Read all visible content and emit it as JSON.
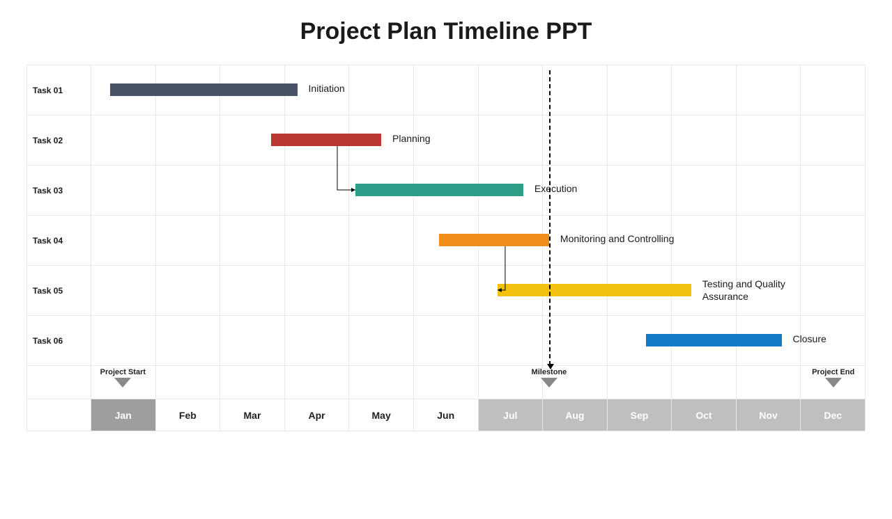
{
  "title": "Project Plan Timeline PPT",
  "months": [
    "Jan",
    "Feb",
    "Mar",
    "Apr",
    "May",
    "Jun",
    "Jul",
    "Aug",
    "Sep",
    "Oct",
    "Nov",
    "Dec"
  ],
  "tasks": [
    {
      "rowLabel": "Task 01",
      "label": "Initiation"
    },
    {
      "rowLabel": "Task 02",
      "label": "Planning"
    },
    {
      "rowLabel": "Task 03",
      "label": "Execution"
    },
    {
      "rowLabel": "Task 04",
      "label": "Monitoring and Controlling"
    },
    {
      "rowLabel": "Task 05",
      "label": "Testing and Quality Assurance"
    },
    {
      "rowLabel": "Task 06",
      "label": "Closure"
    }
  ],
  "markers": {
    "start": "Project Start",
    "milestone": "Milestone",
    "end": "Project End"
  },
  "chart_data": {
    "type": "gantt",
    "title": "Project Plan Timeline PPT",
    "x_axis": {
      "label": "",
      "categories": [
        "Jan",
        "Feb",
        "Mar",
        "Apr",
        "May",
        "Jun",
        "Jul",
        "Aug",
        "Sep",
        "Oct",
        "Nov",
        "Dec"
      ],
      "range": [
        0,
        12
      ]
    },
    "y_axis": {
      "label": "",
      "categories": [
        "Task 01",
        "Task 02",
        "Task 03",
        "Task 04",
        "Task 05",
        "Task 06"
      ]
    },
    "series": [
      {
        "name": "Initiation",
        "row": "Task 01",
        "start": 0.3,
        "end": 3.2,
        "color": "#495166"
      },
      {
        "name": "Planning",
        "row": "Task 02",
        "start": 2.8,
        "end": 4.5,
        "color": "#b93631"
      },
      {
        "name": "Execution",
        "row": "Task 03",
        "start": 4.1,
        "end": 6.7,
        "color": "#2c9e87"
      },
      {
        "name": "Monitoring and Controlling",
        "row": "Task 04",
        "start": 5.4,
        "end": 7.1,
        "color": "#ef8d1c"
      },
      {
        "name": "Testing and Quality Assurance",
        "row": "Task 05",
        "start": 6.3,
        "end": 9.3,
        "color": "#f3c211"
      },
      {
        "name": "Closure",
        "row": "Task 06",
        "start": 8.6,
        "end": 10.7,
        "color": "#147bc9"
      }
    ],
    "dependencies": [
      {
        "from": "Planning",
        "to": "Execution"
      },
      {
        "from": "Monitoring and Controlling",
        "to": "Testing and Quality Assurance"
      }
    ],
    "milestones": [
      {
        "name": "Project Start",
        "month": "Jan",
        "x": 0.5
      },
      {
        "name": "Milestone",
        "month": "Aug",
        "x": 7.1
      },
      {
        "name": "Project End",
        "month": "Dec",
        "x": 11.5
      }
    ],
    "axis_shading": {
      "first_half": "white",
      "second_half": "grey",
      "jan": "darker_grey"
    }
  }
}
